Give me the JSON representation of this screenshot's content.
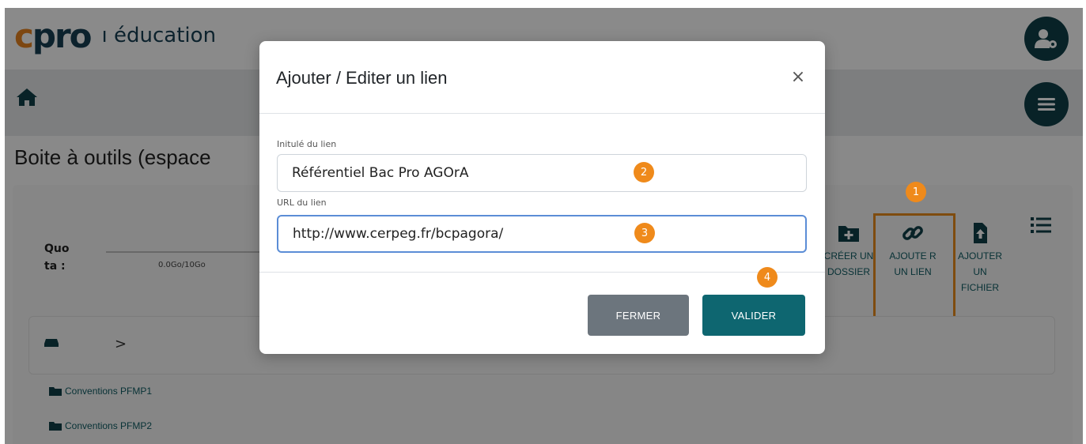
{
  "app": {
    "logo_text_1": "c",
    "logo_text_2": "pro",
    "logo_suffix": "ı éducation"
  },
  "colors": {
    "brand_orange": "#e4811f",
    "brand_dark": "#0f3f48",
    "accent_teal": "#0e6670",
    "annotation_orange": "#ef8a1b"
  },
  "icons": {
    "user_settings": "user-gear-icon",
    "home": "home-icon",
    "menu": "hamburger-icon",
    "close": "close-icon",
    "folder_plus": "folder-plus-icon",
    "link": "link-icon",
    "file_upload": "file-upload-icon",
    "list": "list-icon",
    "drive": "hard-drive-icon",
    "folder": "folder-icon"
  },
  "page": {
    "title": "Boite à outils (espace"
  },
  "quota": {
    "label": "Quo ta :",
    "value": "0.0Go/10Go"
  },
  "actions": {
    "create_folder": "CRÉER UN DOSSIER",
    "add_link": "AJOUTE R UN LIEN",
    "add_file": "AJOUTER UN FICHIER"
  },
  "breadcrumb": {
    "separator": ">"
  },
  "folders": [
    {
      "name": "Conventions PFMP1"
    },
    {
      "name": "Conventions PFMP2"
    }
  ],
  "modal": {
    "title": "Ajouter / Editer un lien",
    "close_symbol": "×",
    "link_label": "Initulé du lien",
    "link_value": "Référentiel Bac Pro AGOrA",
    "url_label": "URL du lien",
    "url_value": "http://www.cerpeg.fr/bcpagora/",
    "close_button": "FERMER",
    "validate_button": "VALIDER"
  },
  "annotations": {
    "step1": "1",
    "step2": "2",
    "step3": "3",
    "step4": "4"
  }
}
